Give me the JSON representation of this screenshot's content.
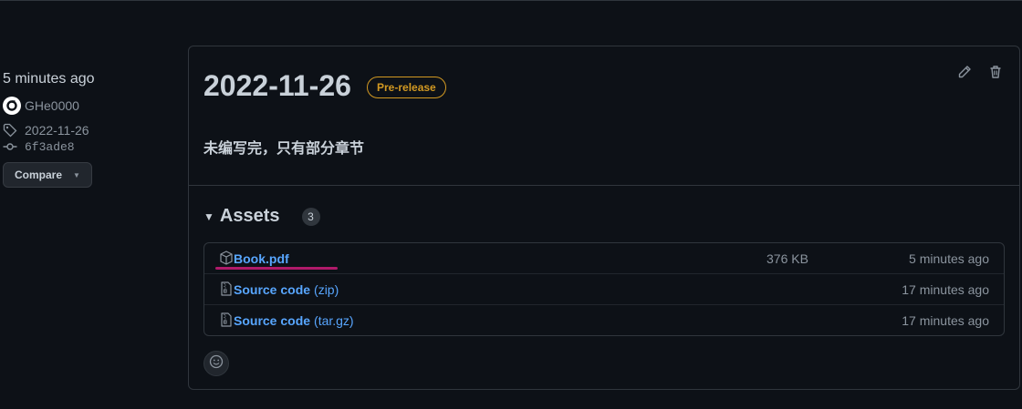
{
  "sidebar": {
    "time": "5 minutes ago",
    "author": "GHe0000",
    "tag": "2022-11-26",
    "commit": "6f3ade8",
    "compare_label": "Compare"
  },
  "release": {
    "title": "2022-11-26",
    "badge": "Pre-release",
    "notes": "未编写完，只有部分章节"
  },
  "assets": {
    "title": "Assets",
    "count": "3",
    "items": [
      {
        "name": "Book.pdf",
        "sub": "",
        "size": "376 KB",
        "time": "5 minutes ago"
      },
      {
        "name": "Source code",
        "sub": "(zip)",
        "size": "",
        "time": "17 minutes ago"
      },
      {
        "name": "Source code",
        "sub": "(tar.gz)",
        "size": "",
        "time": "17 minutes ago"
      }
    ]
  },
  "colors": {
    "background": "#0d1117",
    "link": "#58a6ff",
    "prerelease": "#d29922",
    "highlight": "#b01a6a"
  },
  "icons": [
    "avatar",
    "tag-icon",
    "commit-icon",
    "pencil-icon",
    "trash-icon",
    "package-icon",
    "file-zip-icon",
    "smiley-icon"
  ]
}
